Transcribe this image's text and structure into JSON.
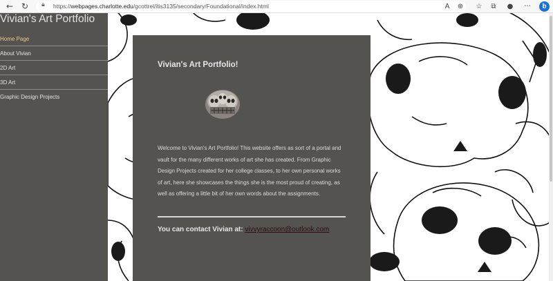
{
  "browser": {
    "url_prefix": "https://",
    "url_host": "webpages.charlotte.edu",
    "url_path": "/gcottrel/itis3135/secondary/Foundational/index.html",
    "icons": [
      "back-icon",
      "refresh-icon",
      "lock-icon",
      "read-aloud-icon",
      "extensions-icon",
      "favorites-icon",
      "collections-icon",
      "profile-icon",
      "more-icon",
      "bing-icon"
    ],
    "tb_glyphs": {
      "read_aloud": "A",
      "extensions": "⊕",
      "favorites": "☆",
      "collections": "⧉",
      "profile": "●",
      "more": "···",
      "bing": "b"
    }
  },
  "sidebar": {
    "site_title": "Vivian's Art Portfolio",
    "items": [
      {
        "label": "Home Page",
        "active": true
      },
      {
        "label": "About Vivian",
        "active": false
      },
      {
        "label": "2D Art",
        "active": false
      },
      {
        "label": "3D Art",
        "active": false
      },
      {
        "label": "Graphic Design Projects",
        "active": false
      }
    ]
  },
  "main": {
    "title": "Vivian's Art Portfolio!",
    "intro": "Welcome to Vivian's Art Portfolio! This website offers as sort of a portal and vault for the many different works of art she has created. From Graphic Design Projects created for her college classes, to her own personal works of art, here she showcases the things she is the most proud of creating, as well as offering a little bit of her own words about the assignments.",
    "contact_label": "You can contact Vivian at:",
    "contact_email": "vivvyraccoon@outlook.com"
  },
  "colors": {
    "panel": "#555350",
    "active_link": "#e6c98e",
    "email_link": "#2a0d0d"
  }
}
